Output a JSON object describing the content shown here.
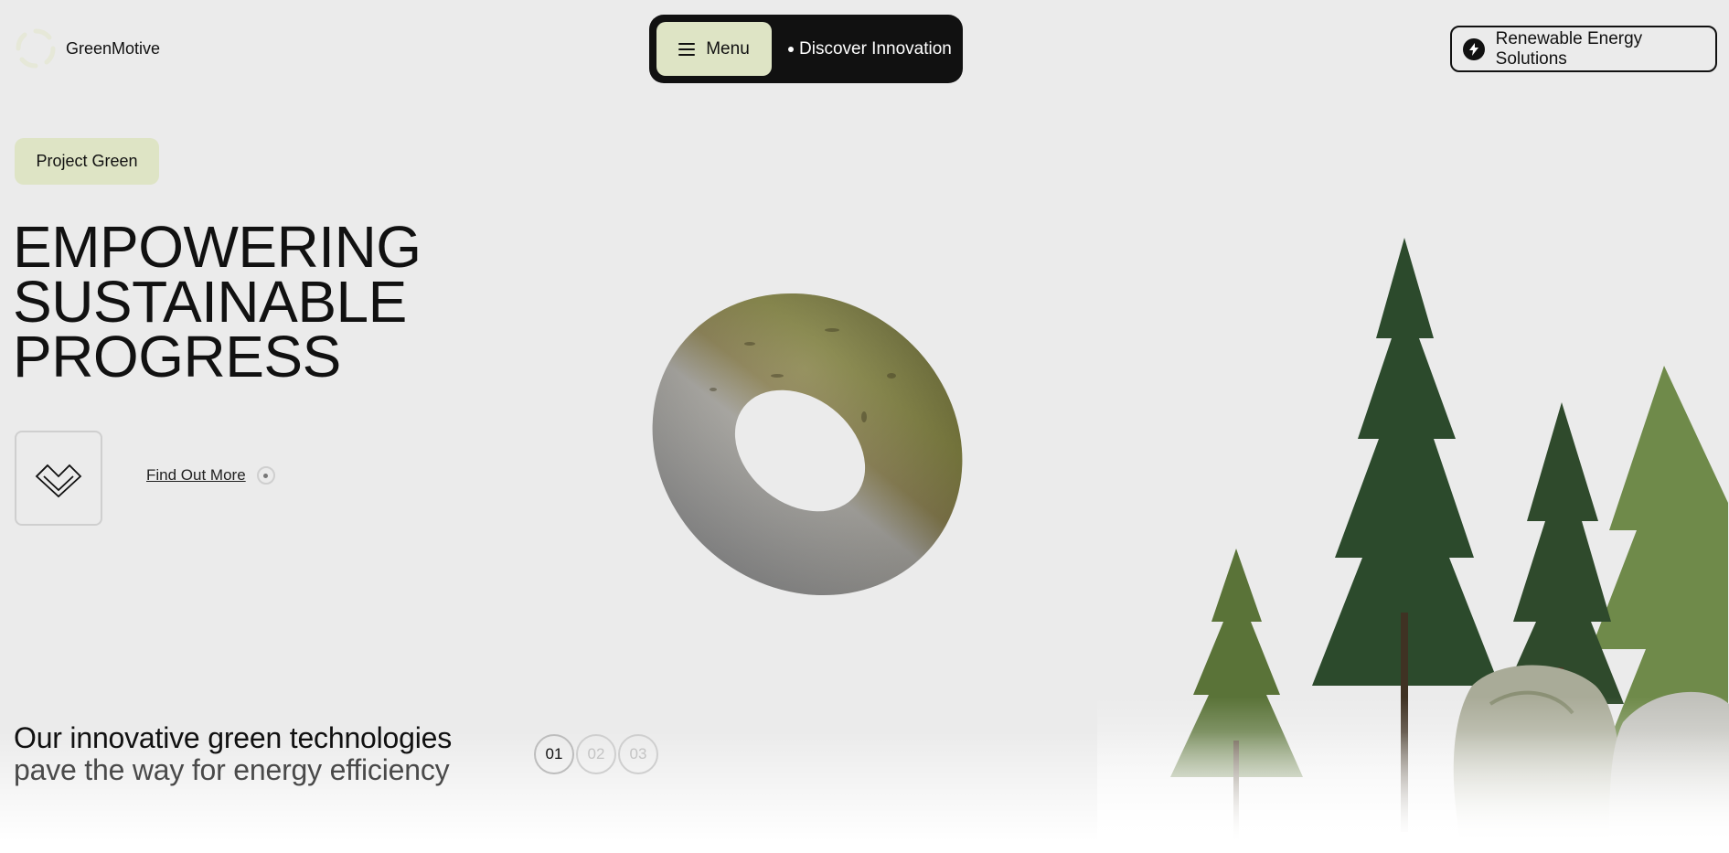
{
  "header": {
    "brand": "GreenMotive",
    "menu_label": "Menu",
    "discover_label": "Discover Innovation",
    "cta_label": "Renewable Energy Solutions"
  },
  "hero": {
    "badge": "Project Green",
    "headline": [
      "EMPOWERING",
      "SUSTAINABLE",
      "PROGRESS"
    ],
    "link_label": "Find Out More"
  },
  "footer": {
    "tagline_line1": "Our innovative green technologies",
    "tagline_line2": "pave the way for energy efficiency",
    "pages": [
      "01",
      "02",
      "03"
    ],
    "active_page": "01"
  },
  "colors": {
    "background": "#ebebeb",
    "accent_pill": "#dee4c5",
    "dark": "#111111",
    "muted": "#c4c4c4"
  },
  "icons": {
    "logo": "spinner-logo-icon",
    "menu": "hamburger-icon",
    "bolt": "lightning-bolt-icon",
    "brand_mark": "double-chevron-heart-icon",
    "link_dot": "circle-dot-icon"
  }
}
